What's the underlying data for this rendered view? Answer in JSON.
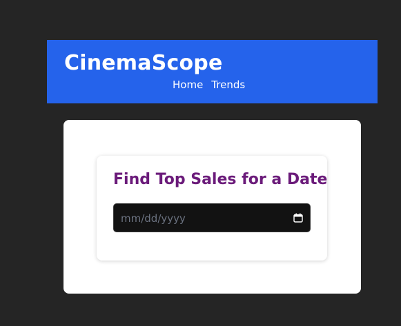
{
  "header": {
    "brand": "CinemaScope",
    "nav": [
      "Home",
      "Trends"
    ]
  },
  "search_card": {
    "title": "Find Top Sales for a Date",
    "date_input": {
      "placeholder": "mm/dd/yyyy",
      "value": "",
      "icon": "calendar-icon"
    }
  },
  "colors": {
    "background": "#252525",
    "header": "#2563eb",
    "title": "#6b1b7a",
    "input": "#121212"
  }
}
